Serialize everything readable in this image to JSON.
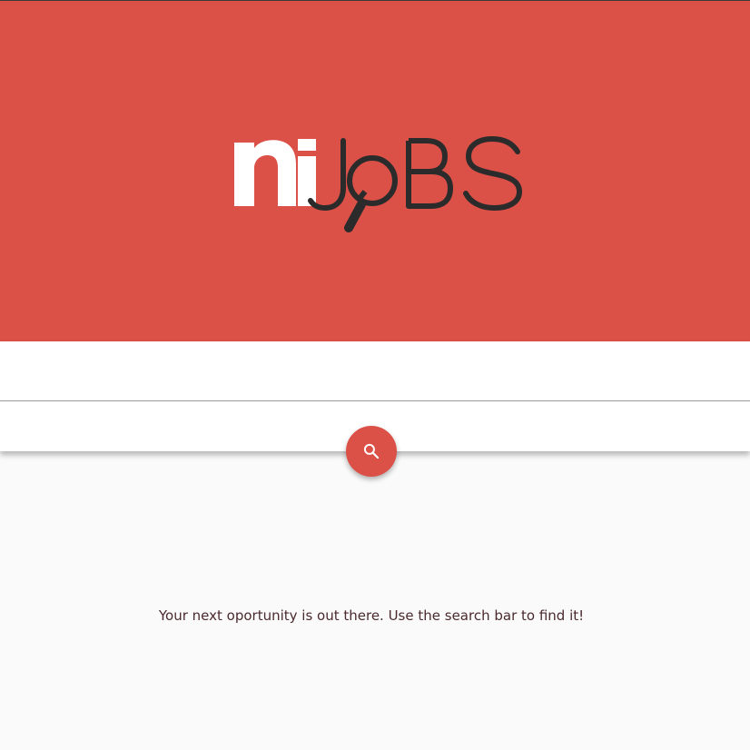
{
  "header": {
    "background_color": "#db5047",
    "logo": {
      "text_light": "ni",
      "text_dark": "JoBS",
      "icon": "magnifier-icon"
    }
  },
  "search": {
    "value": "",
    "button_icon": "search-icon"
  },
  "main": {
    "message": "Your next oportunity is out there. Use the search bar to find it!"
  }
}
